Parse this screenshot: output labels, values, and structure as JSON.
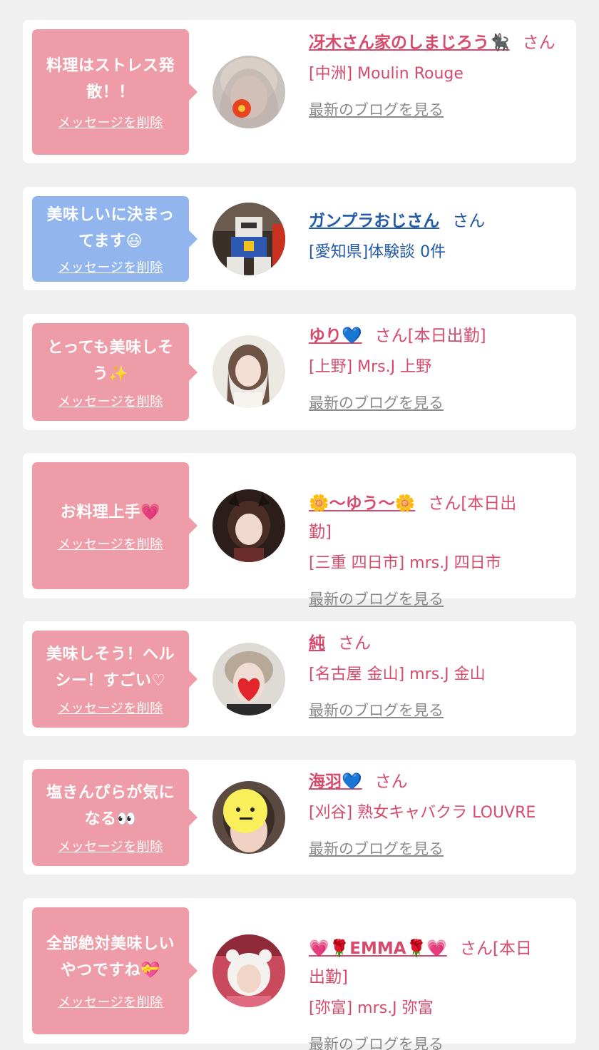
{
  "entries": [
    {
      "message": "料理はストレス発\n散！！",
      "delete_label": "メッセージを削除",
      "name": "冴木さん家のしまじろう🐈‍⬛",
      "honorific": "さん",
      "shop": "[中洲] Moulin Rouge",
      "blog_label": "最新のブログを見る",
      "bubble_color": "#ee9ca8",
      "name_color": "#d64a6b"
    },
    {
      "message": "美味しいに決まっ\nてます😃",
      "delete_label": "メッセージを削除",
      "name": "ガンプラおじさん",
      "honorific": "さん",
      "shop": "[愛知県]体験談 0件",
      "bubble_color": "#93b5ee",
      "name_color": "#225aa8"
    },
    {
      "message": "とっても美味しそ\nう✨",
      "delete_label": "メッセージを削除",
      "name": "ゆり💙",
      "honorific": "さん[本日出勤]",
      "shop": "[上野] Mrs.J 上野",
      "blog_label": "最新のブログを見る",
      "bubble_color": "#ee9ca8",
      "name_color": "#d64a6b"
    },
    {
      "message": "お料理上手💗",
      "delete_label": "メッセージを削除",
      "name": "🌼〜ゆう〜🌼",
      "honorific": "さん[本日出\n勤]",
      "shop": "[三重 四日市] mrs.J 四日市",
      "blog_label": "最新のブログを見る",
      "bubble_color": "#ee9ca8",
      "name_color": "#d64a6b"
    },
    {
      "message": "美味しそう！ヘル\nシー！すごい♡",
      "delete_label": "メッセージを削除",
      "name": "純",
      "honorific": "さん",
      "shop": "[名古屋 金山] mrs.J 金山",
      "blog_label": "最新のブログを見る",
      "bubble_color": "#ee9ca8",
      "name_color": "#d64a6b"
    },
    {
      "message": "塩きんぴらが気に\nなる👀",
      "delete_label": "メッセージを削除",
      "name": "海羽💙",
      "honorific": "さん",
      "shop": "[刈谷] 熟女キャバクラ LOUVRE",
      "blog_label": "最新のブログを見る",
      "bubble_color": "#ee9ca8",
      "name_color": "#d64a6b"
    },
    {
      "message": "全部絶対美味しい\nやつですね💝",
      "delete_label": "メッセージを削除",
      "name": "💗🌹EMMA🌹💗",
      "honorific": "さん[本日\n出勤]",
      "shop": "[弥富] mrs.J 弥富",
      "blog_label": "最新のブログを見る",
      "bubble_color": "#ee9ca8",
      "name_color": "#d64a6b"
    }
  ]
}
